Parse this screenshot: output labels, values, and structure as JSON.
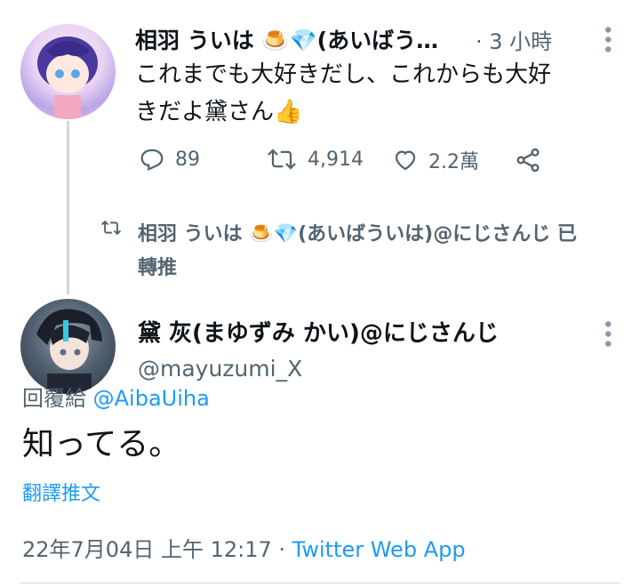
{
  "tweet1": {
    "name": "相羽 ういは 🍮💎(あいばう…",
    "time": "· 3 小時",
    "text_line1": "これまでも大好きだし、これからも大好",
    "text_line2": "きだよ黛さん👍",
    "replies": "89",
    "retweets": "4,914",
    "likes": "2.2萬"
  },
  "retweet_note": {
    "line1": "相羽 ういは 🍮💎(あいばういは)@にじさんじ 已",
    "line2": "轉推"
  },
  "tweet2": {
    "name": "黛 灰(まゆずみ かい)@にじさんじ",
    "handle": "@mayuzumi_X",
    "reply_prefix": "回覆給",
    "reply_to": "@AibaUiha",
    "text": "知ってる。",
    "translate": "翻譯推文",
    "timestamp": "22年7月04日 上午 12:17 · ",
    "source": "Twitter Web App"
  },
  "colors": {
    "accent": "#1d9bf0",
    "muted": "#536471",
    "line": "#cfd9de"
  },
  "icons": [
    "reply-icon",
    "retweet-icon",
    "like-icon",
    "share-icon",
    "more-icon",
    "avatar"
  ]
}
